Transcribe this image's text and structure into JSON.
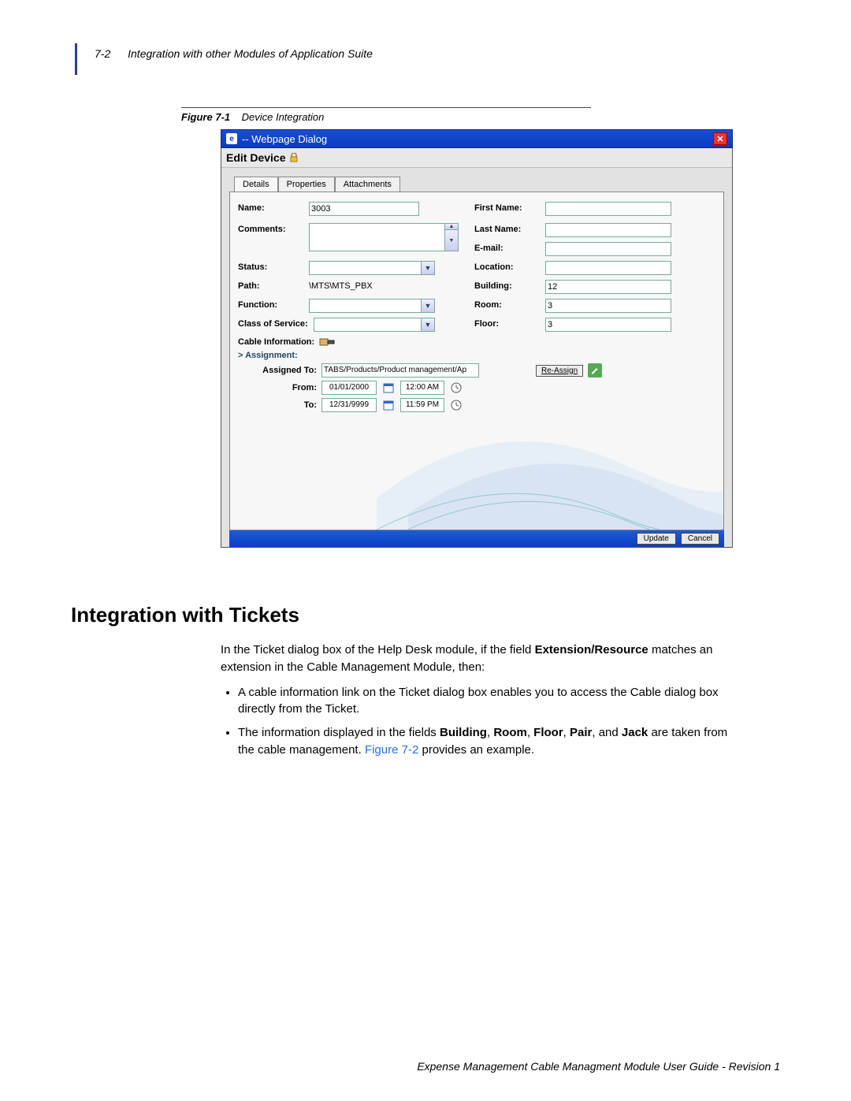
{
  "page": {
    "number": "7-2",
    "chapter_title": "Integration with other Modules of Application Suite",
    "footer": "Expense Management Cable Managment Module User Guide - Revision 1"
  },
  "figure": {
    "label": "Figure 7-1",
    "title": "Device Integration"
  },
  "dialog": {
    "window_title": "-- Webpage Dialog",
    "edit_title": "Edit Device",
    "tabs": {
      "details": "Details",
      "properties": "Properties",
      "attachments": "Attachments"
    },
    "labels": {
      "name": "Name:",
      "comments": "Comments:",
      "status": "Status:",
      "path": "Path:",
      "function": "Function:",
      "cos": "Class of Service:",
      "first_name": "First Name:",
      "last_name": "Last Name:",
      "email": "E-mail:",
      "location": "Location:",
      "building": "Building:",
      "room": "Room:",
      "floor": "Floor:",
      "cable_info": "Cable Information:",
      "assignment_head": "> Assignment:",
      "assigned_to": "Assigned To:",
      "from": "From:",
      "to": "To:"
    },
    "values": {
      "name": "3003",
      "comments": "",
      "status": "",
      "path": "\\MTS\\MTS_PBX",
      "function": "",
      "cos": "",
      "first_name": "",
      "last_name": "",
      "email": "",
      "location": "",
      "building": "12",
      "room": "3",
      "floor": "3",
      "assigned_to": "TABS/Products/Product management/Ap",
      "from_date": "01/01/2000",
      "from_time": "12:00 AM",
      "to_date": "12/31/9999",
      "to_time": "11:59 PM"
    },
    "buttons": {
      "reassign": "Re-Assign",
      "update": "Update",
      "cancel": "Cancel"
    }
  },
  "section": {
    "heading": "Integration with Tickets",
    "para1_a": "In the Ticket dialog box of the Help Desk module, if the field ",
    "para1_b": "Extension/Resource",
    "para1_c": " matches an extension in the Cable Management Module, then:",
    "bullet1": "A cable information link on the Ticket dialog box enables you to access the Cable dialog box directly from the Ticket.",
    "bullet2_a": "The information displayed in the fields ",
    "bullet2_b": "Building",
    "bullet2_c": ", ",
    "bullet2_d": "Room",
    "bullet2_e": ", ",
    "bullet2_f": "Floor",
    "bullet2_g": ", ",
    "bullet2_h": "Pair",
    "bullet2_i": ", and ",
    "bullet2_j": "Jack",
    "bullet2_k": " are taken from the cable management. ",
    "bullet2_ref": "Figure 7-2",
    "bullet2_l": " provides an example."
  }
}
